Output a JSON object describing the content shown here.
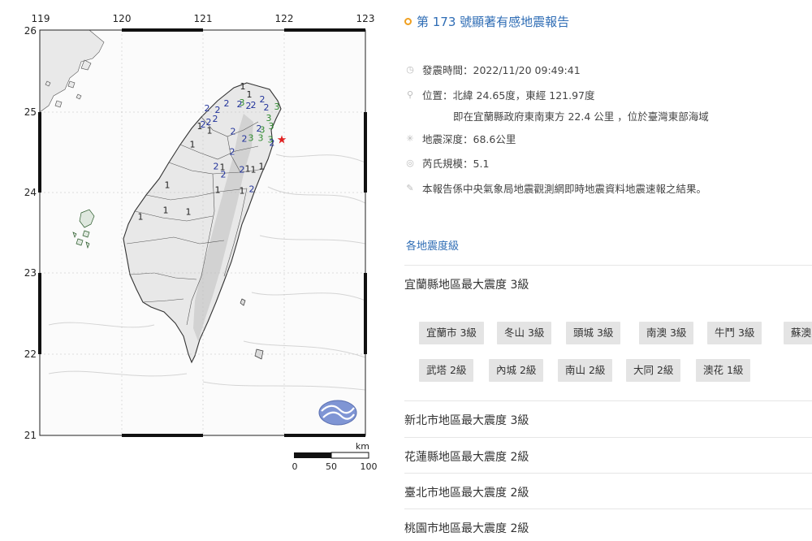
{
  "map": {
    "lon_ticks": [
      "119",
      "120",
      "121",
      "122",
      "123"
    ],
    "lat_ticks": [
      "26",
      "25",
      "24",
      "23",
      "22",
      "21"
    ],
    "scale": {
      "unit": "km",
      "labels": [
        "0",
        "50",
        "100"
      ]
    },
    "epicenter": {
      "lon": 121.97,
      "lat": 24.65
    },
    "intensity_markers": [
      {
        "v": "1",
        "lon": 121.49,
        "lat": 25.27,
        "c": "#222"
      },
      {
        "v": "1",
        "lon": 121.57,
        "lat": 25.17,
        "c": "#222"
      },
      {
        "v": "2",
        "lon": 121.73,
        "lat": 25.11,
        "c": "#22339b"
      },
      {
        "v": "2",
        "lon": 121.78,
        "lat": 25.01,
        "c": "#22339b"
      },
      {
        "v": "3",
        "lon": 121.91,
        "lat": 25.02,
        "c": "#2f8a2f"
      },
      {
        "v": "2",
        "lon": 121.29,
        "lat": 25.06,
        "c": "#22339b"
      },
      {
        "v": "2",
        "lon": 121.45,
        "lat": 25.05,
        "c": "#22339b"
      },
      {
        "v": "3",
        "lon": 121.48,
        "lat": 25.07,
        "c": "#2f8a2f"
      },
      {
        "v": "2",
        "lon": 121.56,
        "lat": 25.03,
        "c": "#22339b"
      },
      {
        "v": "2",
        "lon": 121.62,
        "lat": 25.04,
        "c": "#22339b"
      },
      {
        "v": "2",
        "lon": 121.05,
        "lat": 25.0,
        "c": "#22339b"
      },
      {
        "v": "2",
        "lon": 121.18,
        "lat": 24.98,
        "c": "#22339b"
      },
      {
        "v": "2",
        "lon": 121.15,
        "lat": 24.87,
        "c": "#22339b"
      },
      {
        "v": "2",
        "lon": 121.07,
        "lat": 24.83,
        "c": "#22339b"
      },
      {
        "v": "2",
        "lon": 121.0,
        "lat": 24.8,
        "c": "#22339b"
      },
      {
        "v": "1",
        "lon": 120.96,
        "lat": 24.78,
        "c": "#222"
      },
      {
        "v": "1",
        "lon": 121.08,
        "lat": 24.72,
        "c": "#222"
      },
      {
        "v": "3",
        "lon": 121.81,
        "lat": 24.88,
        "c": "#2f8a2f"
      },
      {
        "v": "2",
        "lon": 121.69,
        "lat": 24.75,
        "c": "#22339b"
      },
      {
        "v": "3",
        "lon": 121.73,
        "lat": 24.73,
        "c": "#2f8a2f"
      },
      {
        "v": "3",
        "lon": 121.84,
        "lat": 24.78,
        "c": "#2f8a2f"
      },
      {
        "v": "2",
        "lon": 121.37,
        "lat": 24.71,
        "c": "#22339b"
      },
      {
        "v": "2",
        "lon": 121.51,
        "lat": 24.62,
        "c": "#22339b"
      },
      {
        "v": "3",
        "lon": 121.59,
        "lat": 24.63,
        "c": "#2f8a2f"
      },
      {
        "v": "3",
        "lon": 121.71,
        "lat": 24.63,
        "c": "#2f8a2f"
      },
      {
        "v": "3",
        "lon": 121.83,
        "lat": 24.61,
        "c": "#2f8a2f"
      },
      {
        "v": "2",
        "lon": 121.85,
        "lat": 24.57,
        "c": "#22339b"
      },
      {
        "v": "2",
        "lon": 121.36,
        "lat": 24.46,
        "c": "#22339b"
      },
      {
        "v": "1",
        "lon": 120.87,
        "lat": 24.55,
        "c": "#222"
      },
      {
        "v": "2",
        "lon": 121.16,
        "lat": 24.28,
        "c": "#22339b"
      },
      {
        "v": "1",
        "lon": 121.24,
        "lat": 24.27,
        "c": "#222"
      },
      {
        "v": "2",
        "lon": 121.25,
        "lat": 24.18,
        "c": "#22339b"
      },
      {
        "v": "2",
        "lon": 121.48,
        "lat": 24.24,
        "c": "#22339b"
      },
      {
        "v": "1",
        "lon": 121.55,
        "lat": 24.25,
        "c": "#222"
      },
      {
        "v": "1",
        "lon": 121.62,
        "lat": 24.24,
        "c": "#222"
      },
      {
        "v": "1",
        "lon": 121.72,
        "lat": 24.28,
        "c": "#222"
      },
      {
        "v": "1",
        "lon": 120.56,
        "lat": 24.05,
        "c": "#222"
      },
      {
        "v": "1",
        "lon": 121.18,
        "lat": 23.99,
        "c": "#222"
      },
      {
        "v": "1",
        "lon": 121.48,
        "lat": 23.98,
        "c": "#222"
      },
      {
        "v": "2",
        "lon": 121.6,
        "lat": 24.0,
        "c": "#22339b"
      },
      {
        "v": "1",
        "lon": 120.54,
        "lat": 23.74,
        "c": "#222"
      },
      {
        "v": "1",
        "lon": 120.82,
        "lat": 23.72,
        "c": "#222"
      },
      {
        "v": "1",
        "lon": 120.23,
        "lat": 23.66,
        "c": "#222"
      }
    ]
  },
  "report": {
    "title": "第 173 號顯著有感地震報告",
    "time_label": "發震時間：",
    "time_value": "2022/11/20 09:49:41",
    "location_label": "位置：",
    "location_value": "北緯 24.65度，東經 121.97度",
    "location_detail": "即在宜蘭縣政府東南東方 22.4 公里 ，位於臺灣東部海域",
    "depth_label": "地震深度：",
    "depth_value": "68.6公里",
    "magnitude_label": "芮氏規模：",
    "magnitude_value": "5.1",
    "note": "本報告係中央氣象局地震觀測網即時地震資料地震速報之結果。"
  },
  "section_title": "各地震度級",
  "regions": [
    {
      "name": "宜蘭縣地區最大震度 3級",
      "stations": [
        {
          "label": "宜蘭市 3級"
        },
        {
          "label": "冬山 3級"
        },
        {
          "label": "頭城 3級"
        },
        {
          "label": "南澳 3級"
        },
        {
          "label": "牛鬥 3級"
        },
        {
          "label": "蘇澳"
        },
        {
          "label": "武塔 2級"
        },
        {
          "label": "內城 2級"
        },
        {
          "label": "南山 2級"
        },
        {
          "label": "大同 2級"
        },
        {
          "label": "澳花 1級"
        }
      ]
    },
    {
      "name": "新北市地區最大震度 3級"
    },
    {
      "name": "花蓮縣地區最大震度 2級"
    },
    {
      "name": "臺北市地區最大震度 2級"
    },
    {
      "name": "桃園市地區最大震度 2級"
    }
  ],
  "colors": {
    "accent": "#2f6db5",
    "title_dot": "#f0a020",
    "epicenter": "#e02020",
    "chip_bg": "#e4e4e4",
    "intensity_1": "#222222",
    "intensity_2": "#22339b",
    "intensity_3": "#2f8a2f",
    "logo": "#7f95d4"
  }
}
